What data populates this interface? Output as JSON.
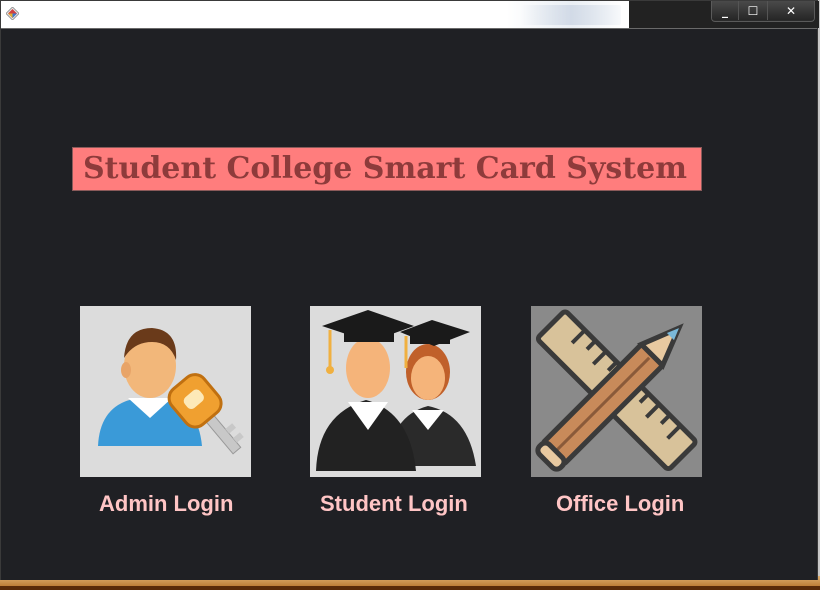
{
  "window": {
    "controls": {
      "minimize": "_",
      "maximize": "☐",
      "close": "✕"
    }
  },
  "main": {
    "title": "Student College Smart Card System",
    "logins": [
      {
        "label": "Admin Login",
        "icon": "admin-key-icon"
      },
      {
        "label": "Student Login",
        "icon": "graduates-icon"
      },
      {
        "label": "Office Login",
        "icon": "pencil-ruler-icon"
      }
    ]
  },
  "colors": {
    "background": "#1f2024",
    "banner": "#ff7d7d",
    "banner_text": "#8e3b3b",
    "label_text": "#ffc5c5"
  }
}
